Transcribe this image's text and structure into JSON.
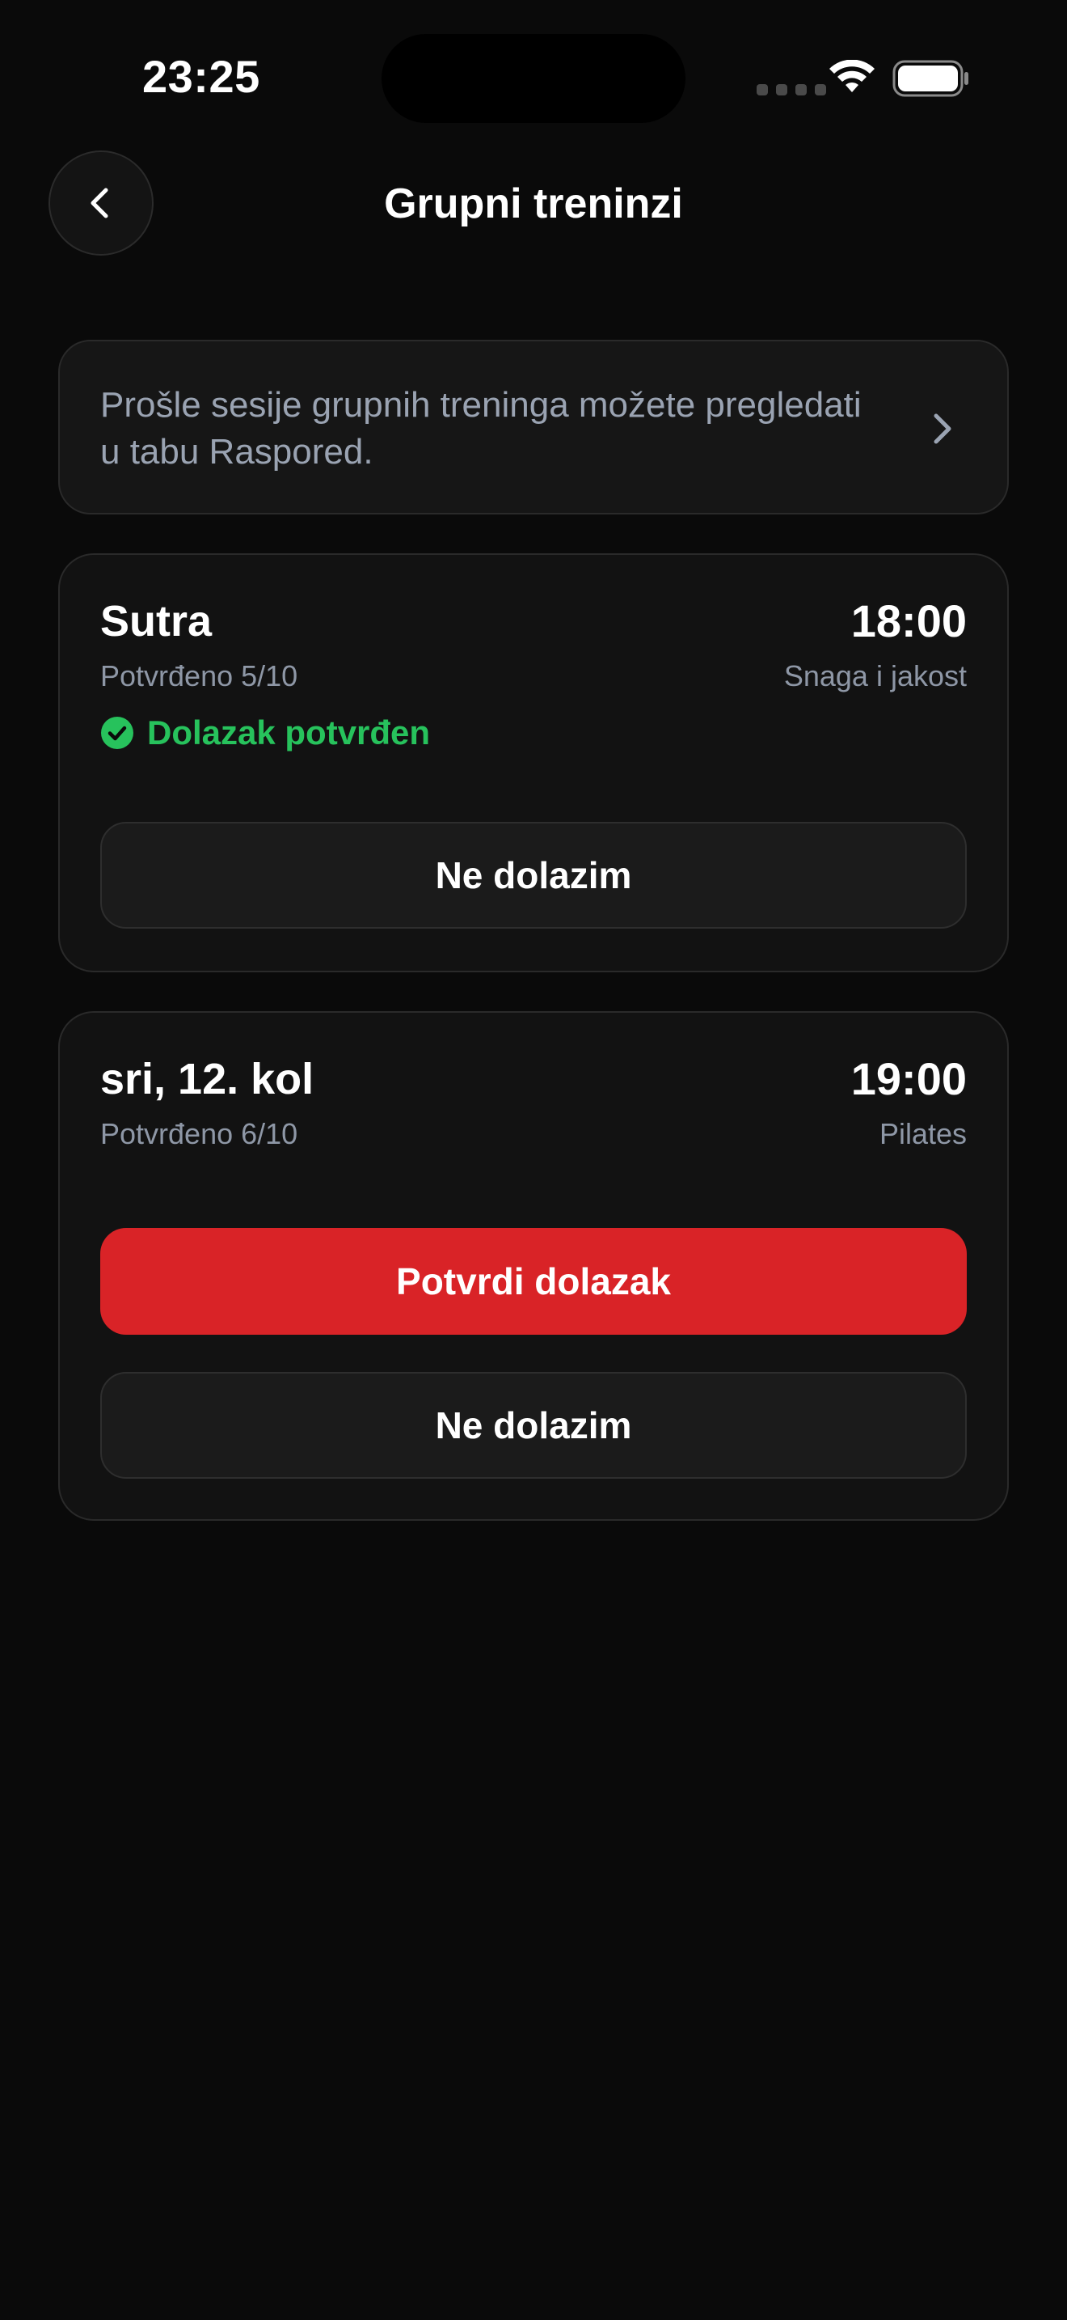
{
  "status_bar": {
    "time": "23:25"
  },
  "header": {
    "title": "Grupni treninzi",
    "back_icon": "chevron-left-icon"
  },
  "info_banner": {
    "text": "Prošle sesije grupnih treninga možete pregledati u tabu Raspored.",
    "icon": "chevron-right-icon"
  },
  "sessions": [
    {
      "day": "Sutra",
      "time": "18:00",
      "confirmed": "Potvrđeno 5/10",
      "type": "Snaga i jakost",
      "attendance_status": "Dolazak potvrđen",
      "decline_label": "Ne dolazim"
    },
    {
      "day": "sri, 12. kol",
      "time": "19:00",
      "confirmed": "Potvrđeno 6/10",
      "type": "Pilates",
      "confirm_label": "Potvrdi dolazak",
      "decline_label": "Ne dolazim"
    }
  ],
  "colors": {
    "background": "#0a0a0a",
    "card": "#121212",
    "accent_red": "#d92327",
    "success_green": "#27c25c",
    "muted_text": "#8e97a6"
  }
}
